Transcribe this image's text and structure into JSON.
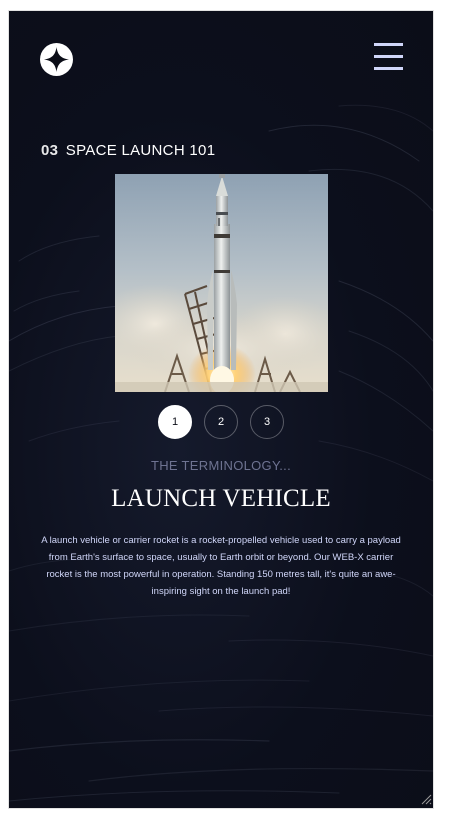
{
  "header": {
    "logo_icon": "star-compass-icon",
    "menu_icon": "hamburger-menu-icon"
  },
  "page": {
    "heading_number": "03",
    "heading_text": "SPACE LAUNCH 101"
  },
  "gallery": {
    "image_alt": "Rocket launching from launch pad",
    "pagination": [
      "1",
      "2",
      "3"
    ],
    "active_index": 0
  },
  "content": {
    "subtitle": "THE TERMINOLOGY...",
    "title": "LAUNCH VEHICLE",
    "description": "A launch vehicle or carrier rocket is a rocket-propelled vehicle used to carry a payload from Earth's surface to space, usually to Earth orbit or beyond. Our WEB-X carrier rocket is the most powerful in operation. Standing 150 metres tall, it's quite an awe-inspiring sight on the launch pad!"
  },
  "colors": {
    "background": "#0b0d17",
    "text": "#ffffff",
    "accent": "#d0d6f9",
    "muted": "#6e7391"
  }
}
